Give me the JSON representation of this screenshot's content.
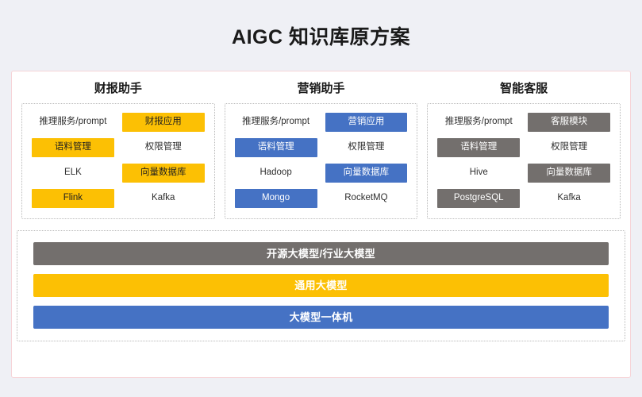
{
  "header": {
    "title": "AIGC 知识库原方案"
  },
  "theme": {
    "background": "#eff0f5",
    "card_background": "#ffffff",
    "card_border": "#f6d4d8",
    "box_border": "#b8b8b8",
    "yellow": "#fcc004",
    "blue": "#4572c4",
    "gray": "#736f6d",
    "text": "#2f2f2f"
  },
  "columns": [
    {
      "title": "财报助手",
      "accent": "#fcc004",
      "cells": [
        {
          "label": "推理服务/prompt",
          "style": "plain"
        },
        {
          "label": "财报应用",
          "style": "badge-yellow"
        },
        {
          "label": "语料管理",
          "style": "badge-yellow"
        },
        {
          "label": "权限管理",
          "style": "plain"
        },
        {
          "label": "ELK",
          "style": "plain"
        },
        {
          "label": "向量数据库",
          "style": "badge-yellow"
        },
        {
          "label": "Flink",
          "style": "badge-yellow"
        },
        {
          "label": "Kafka",
          "style": "plain"
        }
      ]
    },
    {
      "title": "营销助手",
      "accent": "#4572c4",
      "cells": [
        {
          "label": "推理服务/prompt",
          "style": "plain"
        },
        {
          "label": "营销应用",
          "style": "badge-blue"
        },
        {
          "label": "语料管理",
          "style": "badge-blue"
        },
        {
          "label": "权限管理",
          "style": "plain"
        },
        {
          "label": "Hadoop",
          "style": "plain"
        },
        {
          "label": "向量数据库",
          "style": "badge-blue"
        },
        {
          "label": "Mongo",
          "style": "badge-blue"
        },
        {
          "label": "RocketMQ",
          "style": "plain"
        }
      ]
    },
    {
      "title": "智能客服",
      "accent": "#736f6d",
      "cells": [
        {
          "label": "推理服务/prompt",
          "style": "plain"
        },
        {
          "label": "客服模块",
          "style": "badge-gray"
        },
        {
          "label": "语料管理",
          "style": "badge-gray"
        },
        {
          "label": "权限管理",
          "style": "plain"
        },
        {
          "label": "Hive",
          "style": "plain"
        },
        {
          "label": "向量数据库",
          "style": "badge-gray"
        },
        {
          "label": "PostgreSQL",
          "style": "badge-gray"
        },
        {
          "label": "Kafka",
          "style": "plain"
        }
      ]
    }
  ],
  "foundation": {
    "bars": [
      {
        "label": "开源大模型/行业大模型",
        "style": "gray"
      },
      {
        "label": "通用大模型",
        "style": "yellow"
      },
      {
        "label": "大模型一体机",
        "style": "blue"
      }
    ]
  }
}
